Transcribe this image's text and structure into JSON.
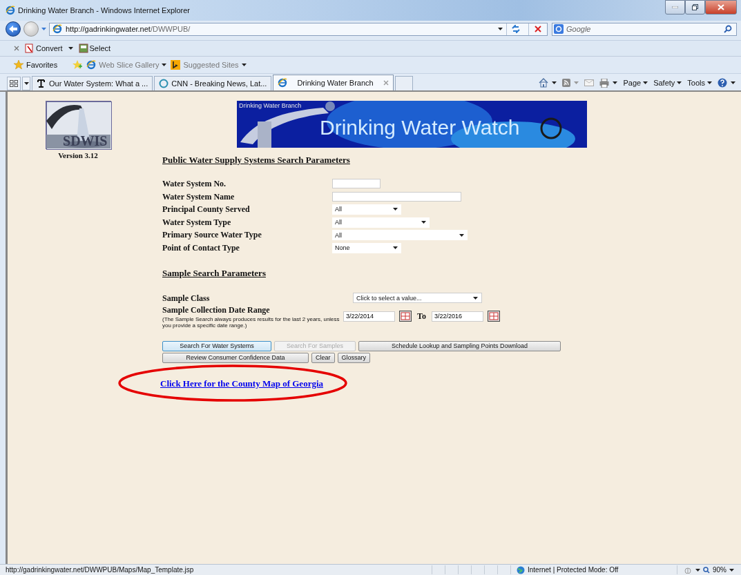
{
  "window": {
    "title": "Drinking Water Branch - Windows Internet Explorer"
  },
  "address_bar": {
    "url_host": "http://gadrinkingwater.net",
    "url_path": "/DWWPUB/"
  },
  "search_box": {
    "placeholder": "Google"
  },
  "command_bar": [
    {
      "label": "Convert",
      "kind": "pdf"
    },
    {
      "label": "Select",
      "kind": "select"
    }
  ],
  "favorites_bar": [
    {
      "label": "Favorites",
      "kind": "star"
    },
    {
      "label": "Web Slice Gallery",
      "kind": "ie"
    },
    {
      "label": "Suggested Sites",
      "kind": "bing"
    }
  ],
  "tabs": [
    {
      "label": "Our Water System: What a ...",
      "kind": "news",
      "selected": false
    },
    {
      "label": "CNN - Breaking News, Lat...",
      "kind": "globe",
      "selected": false
    },
    {
      "label": "Drinking Water Branch",
      "kind": "ie",
      "selected": true
    }
  ],
  "toolbar": [
    {
      "label": "Page"
    },
    {
      "label": "Safety"
    },
    {
      "label": "Tools"
    }
  ],
  "page": {
    "logo": {
      "text": "SDWIS",
      "version": "Version 3.12"
    },
    "banner": {
      "subtitle": "Drinking Water Branch",
      "title": "Drinking Water Watch"
    },
    "heading": "Public Water Supply Systems Search Parameters",
    "fields": [
      {
        "label": "Water System No.",
        "kind": "text"
      },
      {
        "label": "Water System Name",
        "kind": "text"
      },
      {
        "label": "Principal County Served",
        "kind": "select",
        "value": "All"
      },
      {
        "label": "Water System Type",
        "kind": "select",
        "value": "All"
      },
      {
        "label": "Primary Source Water Type",
        "kind": "select",
        "value": "All"
      },
      {
        "label": "Point of Contact Type",
        "kind": "select",
        "value": "None"
      }
    ],
    "sample_heading": "Sample Search Parameters",
    "sample_class": {
      "label": "Sample Class",
      "value": "Click to select a value..."
    },
    "date_range": {
      "label": "Sample Collection Date Range",
      "note": "(The Sample Search always produces results for the last 2 years, unless you provide a specific date range.)",
      "from": "3/22/2014",
      "to_label": "To",
      "to": "3/22/2016"
    },
    "button_rows": [
      [
        {
          "label": "Search For Water Systems",
          "disabled": false,
          "focused": true
        },
        {
          "label": "Search For Samples",
          "disabled": true,
          "focused": false
        },
        {
          "label": "Schedule Lookup and Sampling Points Download",
          "disabled": false,
          "focused": false
        }
      ],
      [
        {
          "label": "Review Consumer Confidence Data",
          "disabled": false,
          "focused": false
        },
        {
          "label": "Clear",
          "disabled": false,
          "focused": false
        },
        {
          "label": "Glossary",
          "disabled": false,
          "focused": false
        }
      ]
    ],
    "link": {
      "label": "Click Here for the County Map of Georgia",
      "circled": true
    }
  },
  "status_bar": {
    "url": "http://gadrinkingwater.net/DWWPUB/Maps/Map_Template.jsp",
    "zone": "Internet | Protected Mode: Off",
    "zoom": "90%"
  }
}
